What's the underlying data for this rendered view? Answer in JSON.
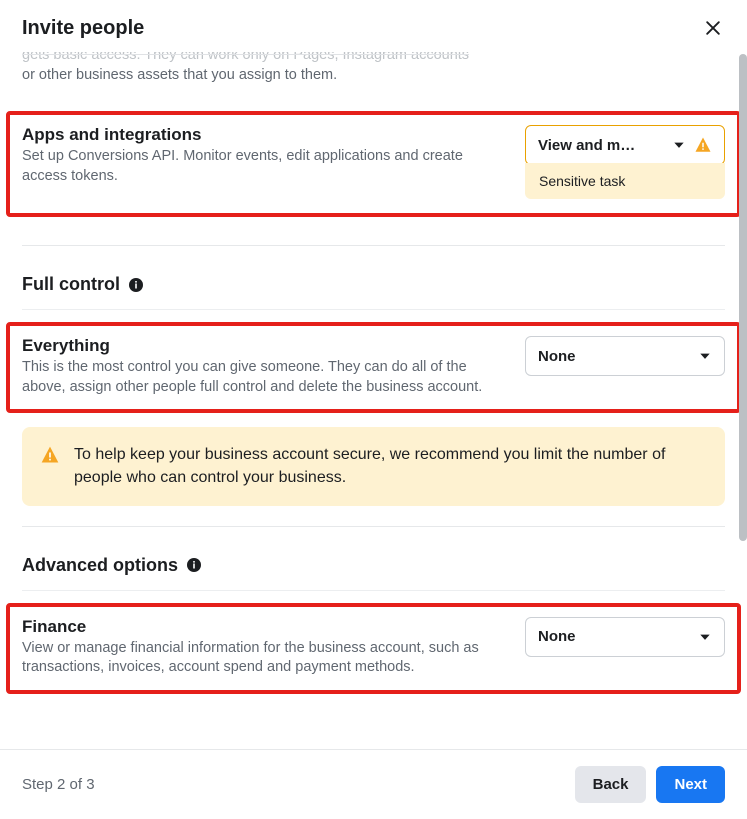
{
  "header": {
    "title": "Invite people"
  },
  "truncated_top": {
    "line1": "gets basic access. They can work only on Pages, Instagram accounts",
    "line2": "or other business assets that you assign to them."
  },
  "apps_integrations": {
    "title": "Apps and integrations",
    "desc": "Set up Conversions API. Monitor events, edit applications and create access tokens.",
    "dropdown_value": "View and m…",
    "sensitive_label": "Sensitive task"
  },
  "full_control": {
    "heading": "Full control",
    "everything_title": "Everything",
    "everything_desc": "This is the most control you can give someone. They can do all of the above, assign other people full control and delete the business account.",
    "everything_value": "None",
    "warning_text": "To help keep your business account secure, we recommend you limit the number of people who can control your business."
  },
  "advanced": {
    "heading": "Advanced options",
    "finance_title": "Finance",
    "finance_desc": "View or manage financial information for the business account, such as transactions, invoices, account spend and payment methods.",
    "finance_value": "None"
  },
  "footer": {
    "step": "Step 2 of 3",
    "back": "Back",
    "next": "Next"
  }
}
